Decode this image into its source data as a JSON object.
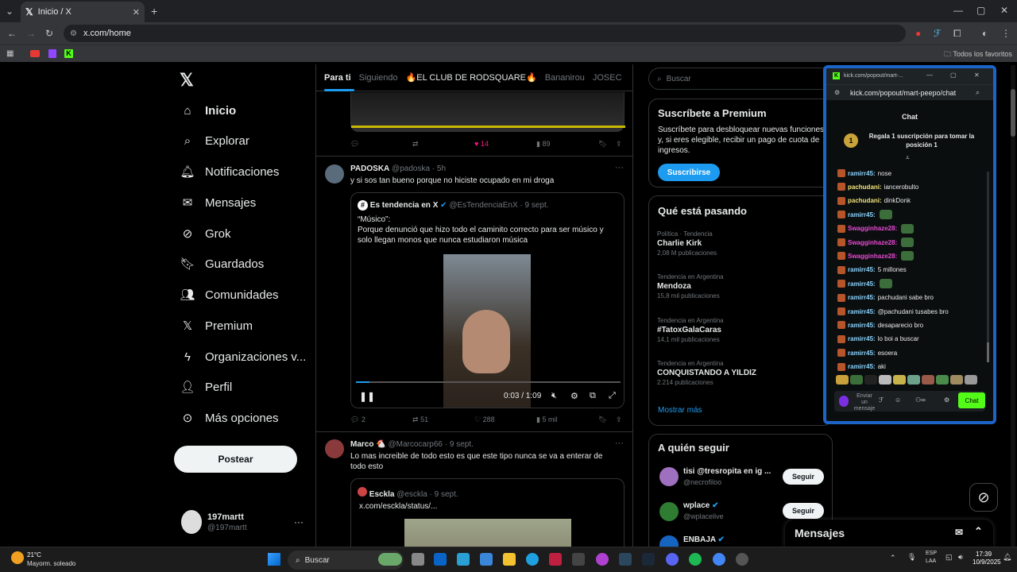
{
  "browser": {
    "tab_title": "Inicio / X",
    "url": "x.com/home",
    "bookmarks_folder": "Todos los favoritos"
  },
  "nav": {
    "items": [
      {
        "label": "Inicio",
        "icon": "home-icon"
      },
      {
        "label": "Explorar",
        "icon": "search-icon"
      },
      {
        "label": "Notificaciones",
        "icon": "bell-icon"
      },
      {
        "label": "Mensajes",
        "icon": "mail-icon"
      },
      {
        "label": "Grok",
        "icon": "grok-icon"
      },
      {
        "label": "Guardados",
        "icon": "bookmark-icon"
      },
      {
        "label": "Comunidades",
        "icon": "people-icon"
      },
      {
        "label": "Premium",
        "icon": "x-icon"
      },
      {
        "label": "Organizaciones v...",
        "icon": "lightning-icon"
      },
      {
        "label": "Perfil",
        "icon": "person-icon"
      },
      {
        "label": "Más opciones",
        "icon": "more-circle-icon"
      }
    ],
    "post_label": "Postear",
    "account_name": "197martt",
    "account_handle": "@197martt"
  },
  "feed": {
    "tabs": [
      "Para ti",
      "Siguiendo",
      "🔥EL CLUB DE RODSQUARE🔥",
      "Bananirou",
      "JOSEC"
    ],
    "top_tweet_actions": {
      "likes": "14",
      "views": "89"
    },
    "tweet1": {
      "name": "PADOSKA",
      "handle": "@padoska",
      "time": "· 5h",
      "text": "y si sos tan bueno porque no hiciste ocupado en mi droga",
      "quote_name": "Es tendencia en X",
      "quote_handle": "@EsTendenciaEnX",
      "quote_time": "· 9 sept.",
      "quote_title": "“Músico”:",
      "quote_text": "Porque denunció que hizo todo el caminito correcto para ser músico y solo llegan monos que nunca estudiaron música",
      "video_time": "0:03 / 1:09",
      "video_progress": 0.05,
      "replies": "2",
      "reposts": "51",
      "likes": "288",
      "views": "5 mil"
    },
    "tweet2": {
      "name": "Marco 🐔",
      "handle": "@Marcocarp66",
      "time": "· 9 sept.",
      "text": "Lo mas increible de todo esto es que este tipo nunca se va a enterar de todo esto",
      "quote_name": "Esckla",
      "quote_handle": "@esckla",
      "quote_time": "· 9 sept.",
      "quote_text": "x.com/esckla/status/..."
    }
  },
  "right": {
    "search_placeholder": "Buscar",
    "premium_title": "Suscríbete a Premium",
    "premium_text": "Suscríbete para desbloquear nuevas funciones y, si eres elegible, recibir un pago de cuota de ingresos.",
    "premium_button": "Suscribirse",
    "trends_title": "Qué está pasando",
    "trends": [
      {
        "category": "Política · Tendencia",
        "name": "Charlie Kirk",
        "count": "2,08 M publicaciones"
      },
      {
        "category": "Tendencia en Argentina",
        "name": "Mendoza",
        "count": "15,8 mil publicaciones"
      },
      {
        "category": "Tendencia en Argentina",
        "name": "#TatoxGalaCaras",
        "count": "14,1 mil publicaciones"
      },
      {
        "category": "Tendencia en Argentina",
        "name": "CONQUISTANDO A YILDIZ",
        "count": "2.214 publicaciones"
      }
    ],
    "show_more": "Mostrar más",
    "follow_title": "A quién seguir",
    "follow": [
      {
        "name": "tisi @tresropita en ig ...",
        "handle": "@necrofiloo",
        "button": "Seguir"
      },
      {
        "name": "wplace",
        "handle": "@wplacelive",
        "button": "Seguir"
      },
      {
        "name": "ENBAJA",
        "handle": "",
        "button": ""
      }
    ],
    "messages_label": "Mensajes"
  },
  "kick": {
    "window_title": "kick.com/popout/mart-...",
    "url": "kick.com/popout/mart-peepo/chat",
    "chat_title": "Chat",
    "gift_count": "1",
    "gift_text": "Regala 1 suscripción para tomar la posición 1",
    "messages": [
      {
        "user": "ramirr45:",
        "text": "nose",
        "color": "green"
      },
      {
        "user": "pachudani:",
        "text": "iancerobulto",
        "color": "yellow"
      },
      {
        "user": "pachudani:",
        "text": "dinkDonk",
        "color": "yellow"
      },
      {
        "user": "ramirr45:",
        "text": "",
        "color": "green"
      },
      {
        "user": "Swagginhaze28:",
        "text": "",
        "color": "pink"
      },
      {
        "user": "Swagginhaze28:",
        "text": "",
        "color": "pink"
      },
      {
        "user": "Swagginhaze28:",
        "text": "",
        "color": "pink"
      },
      {
        "user": "ramirr45:",
        "text": "5 millones",
        "color": "green"
      },
      {
        "user": "ramirr45:",
        "text": "",
        "color": "green"
      },
      {
        "user": "ramirr45:",
        "text": "pachudani sabe bro",
        "color": "green"
      },
      {
        "user": "ramirr45:",
        "text": "@pachudani tusabes bro",
        "color": "green"
      },
      {
        "user": "ramirr45:",
        "text": "desaparecio bro",
        "color": "green"
      },
      {
        "user": "ramirr45:",
        "text": "lo boi a buscar",
        "color": "green"
      },
      {
        "user": "ramirr45:",
        "text": "esoera",
        "color": "green"
      },
      {
        "user": "ramirr45:",
        "text": "aki",
        "color": "green"
      }
    ],
    "input_placeholder": "Enviar un mensaje",
    "send_label": "Chat"
  },
  "taskbar": {
    "weather_temp": "21°C",
    "weather_desc": "Mayorm. soleado",
    "search_label": "Buscar",
    "lang_top": "ESP",
    "lang_bottom": "LAA",
    "time": "17:39",
    "date": "10/9/2025"
  },
  "colors": {
    "accent": "#1d9bf0",
    "kick_green": "#53fc18",
    "like_pink": "#f91880"
  }
}
